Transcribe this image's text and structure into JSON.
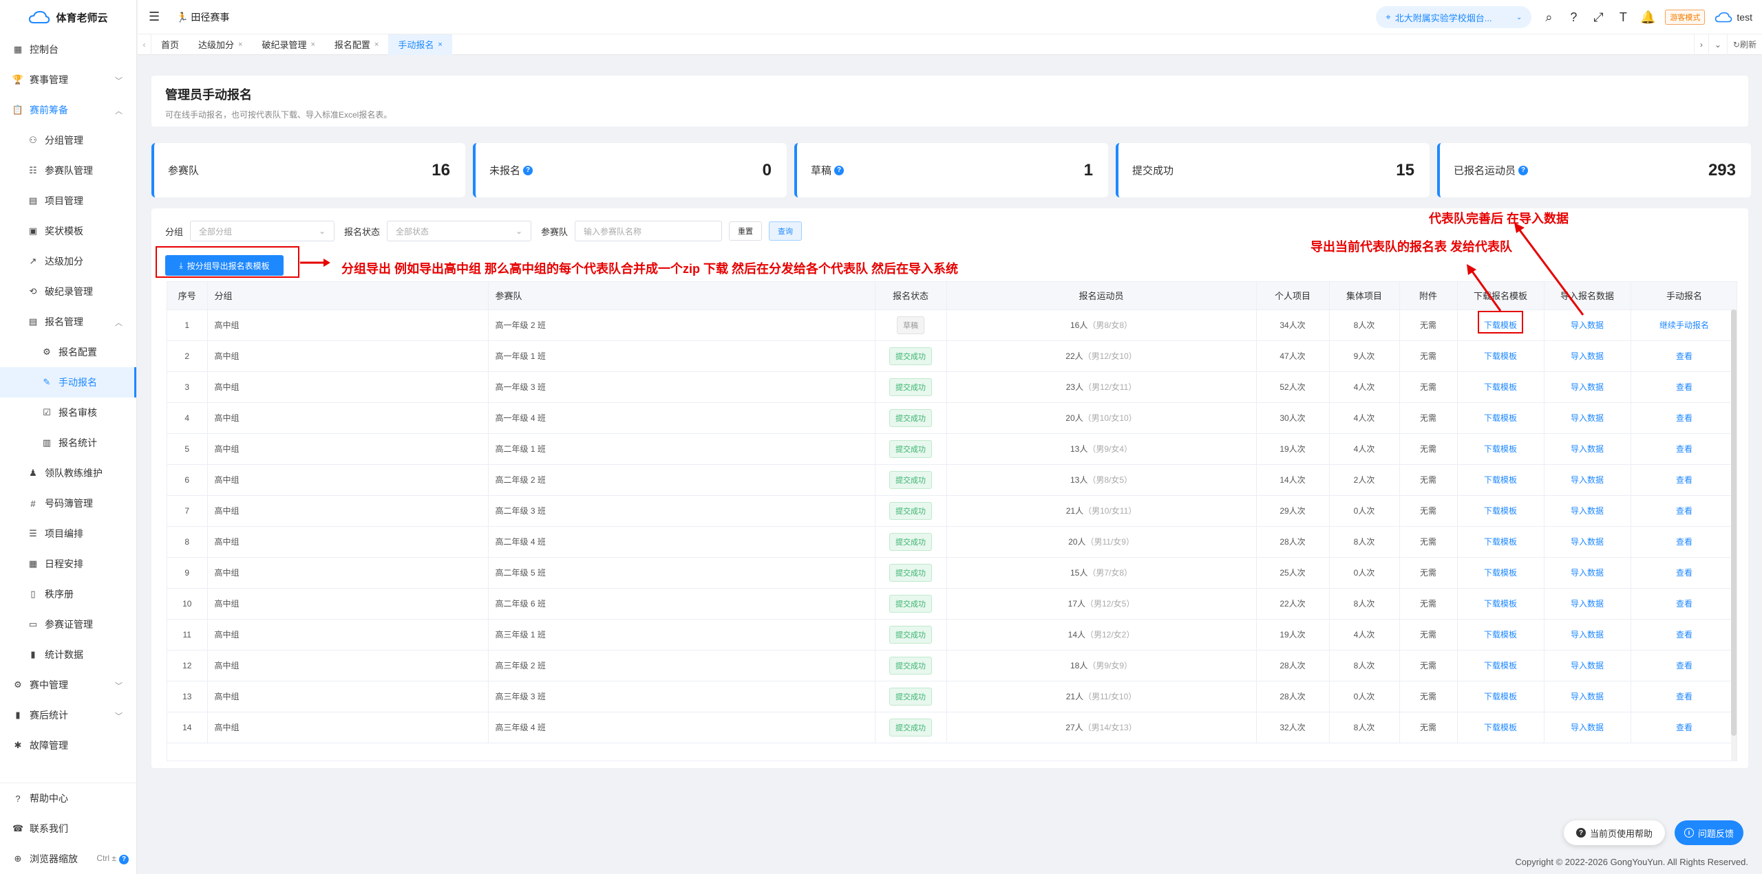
{
  "app": {
    "title": "体育老师云"
  },
  "sidebar": {
    "items": [
      {
        "label": "控制台",
        "icon": "dashboard-icon",
        "level": 0
      },
      {
        "label": "赛事管理",
        "icon": "trophy-icon",
        "level": 0,
        "chevron": true
      },
      {
        "label": "赛前筹备",
        "icon": "clipboard-icon",
        "level": 0,
        "chevron": true,
        "open": true
      },
      {
        "label": "分组管理",
        "icon": "group-icon",
        "level": 1
      },
      {
        "label": "参赛队管理",
        "icon": "team-icon",
        "level": 1
      },
      {
        "label": "项目管理",
        "icon": "document-icon",
        "level": 1
      },
      {
        "label": "奖状模板",
        "icon": "certificate-icon",
        "level": 1
      },
      {
        "label": "达级加分",
        "icon": "chart-icon",
        "level": 1
      },
      {
        "label": "破纪录管理",
        "icon": "record-icon",
        "level": 1
      },
      {
        "label": "报名管理",
        "icon": "register-icon",
        "level": 1,
        "chevron": true,
        "open": true
      },
      {
        "label": "报名配置",
        "icon": "config-icon",
        "level": 2
      },
      {
        "label": "手动报名",
        "icon": "manual-icon",
        "level": 2,
        "active": true
      },
      {
        "label": "报名审核",
        "icon": "audit-icon",
        "level": 2
      },
      {
        "label": "报名统计",
        "icon": "stats-icon",
        "level": 2
      },
      {
        "label": "领队教练维护",
        "icon": "coach-icon",
        "level": 1
      },
      {
        "label": "号码簿管理",
        "icon": "bib-icon",
        "level": 1
      },
      {
        "label": "项目编排",
        "icon": "arrange-icon",
        "level": 1
      },
      {
        "label": "日程安排",
        "icon": "calendar-icon",
        "level": 1
      },
      {
        "label": "秩序册",
        "icon": "book-icon",
        "level": 1
      },
      {
        "label": "参赛证管理",
        "icon": "badge-icon",
        "level": 1
      },
      {
        "label": "统计数据",
        "icon": "bar-chart-icon",
        "level": 1
      },
      {
        "label": "赛中管理",
        "icon": "gear-icon",
        "level": 0,
        "chevron": true
      },
      {
        "label": "赛后统计",
        "icon": "bar-chart-icon",
        "level": 0,
        "chevron": true
      },
      {
        "label": "故障管理",
        "icon": "bug-icon",
        "level": 0
      }
    ],
    "bottom": [
      {
        "label": "帮助中心",
        "icon": "help-icon"
      },
      {
        "label": "联系我们",
        "icon": "phone-icon"
      },
      {
        "label": "浏览器缩放",
        "icon": "zoom-icon",
        "hint": "Ctrl ±"
      }
    ]
  },
  "header": {
    "breadcrumb": "田径赛事",
    "school": "北大附属实验学校烟台...",
    "guest_mode": "游客模式",
    "user": "test"
  },
  "tabs": {
    "items": [
      {
        "label": "首页",
        "closable": false
      },
      {
        "label": "达级加分",
        "closable": true
      },
      {
        "label": "破纪录管理",
        "closable": true
      },
      {
        "label": "报名配置",
        "closable": true
      },
      {
        "label": "手动报名",
        "closable": true,
        "active": true
      }
    ],
    "refresh": "刷新"
  },
  "page": {
    "title": "管理员手动报名",
    "subtitle": "可在线手动报名，也可按代表队下载、导入标准Excel报名表。"
  },
  "stats": [
    {
      "label": "参赛队",
      "value": "16",
      "help": false
    },
    {
      "label": "未报名",
      "value": "0",
      "help": true
    },
    {
      "label": "草稿",
      "value": "1",
      "help": true
    },
    {
      "label": "提交成功",
      "value": "15",
      "help": false
    },
    {
      "label": "已报名运动员",
      "value": "293",
      "help": true
    }
  ],
  "filters": {
    "group_label": "分组",
    "group_placeholder": "全部分组",
    "status_label": "报名状态",
    "status_placeholder": "全部状态",
    "team_label": "参赛队",
    "team_placeholder": "输入参赛队名称",
    "reset": "重置",
    "query": "查询",
    "export": "按分组导出报名表模板"
  },
  "table": {
    "headers": [
      "序号",
      "分组",
      "参赛队",
      "报名状态",
      "报名运动员",
      "个人项目",
      "集体项目",
      "附件",
      "下载报名模板",
      "导入报名数据",
      "手动报名"
    ],
    "rows": [
      {
        "no": "1",
        "group": "高中组",
        "team": "高一年级 2 班",
        "status": "草稿",
        "status_type": "draft",
        "athletes": "16人",
        "gender": "（男8/女8）",
        "individual": "34人次",
        "collective": "8人次",
        "attach": "无需",
        "download": "下载模板",
        "import": "导入数据",
        "manual": "继续手动报名"
      },
      {
        "no": "2",
        "group": "高中组",
        "team": "高一年级 1 班",
        "status": "提交成功",
        "status_type": "success",
        "athletes": "22人",
        "gender": "（男12/女10）",
        "individual": "47人次",
        "collective": "9人次",
        "attach": "无需",
        "download": "下载模板",
        "import": "导入数据",
        "manual": "查看"
      },
      {
        "no": "3",
        "group": "高中组",
        "team": "高一年级 3 班",
        "status": "提交成功",
        "status_type": "success",
        "athletes": "23人",
        "gender": "（男12/女11）",
        "individual": "52人次",
        "collective": "4人次",
        "attach": "无需",
        "download": "下载模板",
        "import": "导入数据",
        "manual": "查看"
      },
      {
        "no": "4",
        "group": "高中组",
        "team": "高一年级 4 班",
        "status": "提交成功",
        "status_type": "success",
        "athletes": "20人",
        "gender": "（男10/女10）",
        "individual": "30人次",
        "collective": "4人次",
        "attach": "无需",
        "download": "下载模板",
        "import": "导入数据",
        "manual": "查看"
      },
      {
        "no": "5",
        "group": "高中组",
        "team": "高二年级 1 班",
        "status": "提交成功",
        "status_type": "success",
        "athletes": "13人",
        "gender": "（男9/女4）",
        "individual": "19人次",
        "collective": "4人次",
        "attach": "无需",
        "download": "下载模板",
        "import": "导入数据",
        "manual": "查看"
      },
      {
        "no": "6",
        "group": "高中组",
        "team": "高二年级 2 班",
        "status": "提交成功",
        "status_type": "success",
        "athletes": "13人",
        "gender": "（男8/女5）",
        "individual": "14人次",
        "collective": "2人次",
        "attach": "无需",
        "download": "下载模板",
        "import": "导入数据",
        "manual": "查看"
      },
      {
        "no": "7",
        "group": "高中组",
        "team": "高二年级 3 班",
        "status": "提交成功",
        "status_type": "success",
        "athletes": "21人",
        "gender": "（男10/女11）",
        "individual": "29人次",
        "collective": "0人次",
        "attach": "无需",
        "download": "下载模板",
        "import": "导入数据",
        "manual": "查看"
      },
      {
        "no": "8",
        "group": "高中组",
        "team": "高二年级 4 班",
        "status": "提交成功",
        "status_type": "success",
        "athletes": "20人",
        "gender": "（男11/女9）",
        "individual": "28人次",
        "collective": "8人次",
        "attach": "无需",
        "download": "下载模板",
        "import": "导入数据",
        "manual": "查看"
      },
      {
        "no": "9",
        "group": "高中组",
        "team": "高二年级 5 班",
        "status": "提交成功",
        "status_type": "success",
        "athletes": "15人",
        "gender": "（男7/女8）",
        "individual": "25人次",
        "collective": "0人次",
        "attach": "无需",
        "download": "下载模板",
        "import": "导入数据",
        "manual": "查看"
      },
      {
        "no": "10",
        "group": "高中组",
        "team": "高二年级 6 班",
        "status": "提交成功",
        "status_type": "success",
        "athletes": "17人",
        "gender": "（男12/女5）",
        "individual": "22人次",
        "collective": "8人次",
        "attach": "无需",
        "download": "下载模板",
        "import": "导入数据",
        "manual": "查看"
      },
      {
        "no": "11",
        "group": "高中组",
        "team": "高三年级 1 班",
        "status": "提交成功",
        "status_type": "success",
        "athletes": "14人",
        "gender": "（男12/女2）",
        "individual": "19人次",
        "collective": "4人次",
        "attach": "无需",
        "download": "下载模板",
        "import": "导入数据",
        "manual": "查看"
      },
      {
        "no": "12",
        "group": "高中组",
        "team": "高三年级 2 班",
        "status": "提交成功",
        "status_type": "success",
        "athletes": "18人",
        "gender": "（男9/女9）",
        "individual": "28人次",
        "collective": "8人次",
        "attach": "无需",
        "download": "下载模板",
        "import": "导入数据",
        "manual": "查看"
      },
      {
        "no": "13",
        "group": "高中组",
        "team": "高三年级 3 班",
        "status": "提交成功",
        "status_type": "success",
        "athletes": "21人",
        "gender": "（男11/女10）",
        "individual": "28人次",
        "collective": "0人次",
        "attach": "无需",
        "download": "下载模板",
        "import": "导入数据",
        "manual": "查看"
      },
      {
        "no": "14",
        "group": "高中组",
        "team": "高三年级 4 班",
        "status": "提交成功",
        "status_type": "success",
        "athletes": "27人",
        "gender": "（男14/女13）",
        "individual": "32人次",
        "collective": "8人次",
        "attach": "无需",
        "download": "下载模板",
        "import": "导入数据",
        "manual": "查看"
      }
    ]
  },
  "annotations": {
    "export_note": "分组导出  例如导出高中组  那么高中组的每个代表队合并成一个zip 下载  然后在分发给各个代表队   然后在导入系统",
    "download_note": "导出当前代表队的报名表 发给代表队",
    "import_note": "代表队完善后 在导入数据"
  },
  "floating": {
    "help": "当前页使用帮助",
    "feedback": "问题反馈"
  },
  "footer": {
    "copyright": "Copyright © 2022-2026 GongYouYun. All Rights Reserved."
  },
  "colors": {
    "primary": "#1e88ff",
    "success": "#3cb371",
    "annotation": "#e60000"
  }
}
